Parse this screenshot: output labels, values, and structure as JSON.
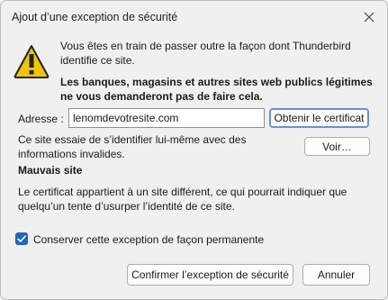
{
  "window": {
    "title": "Ajout d’une exception de sécurité"
  },
  "message": {
    "intro": "Vous êtes en train de passer outre la façon dont Thunderbird identifie ce site.",
    "warning": "Les banques, magasins et autres sites web publics légitimes ne vous demanderont pas de faire cela."
  },
  "address": {
    "label": "Adresse :",
    "value": "lenomdevotresite.com",
    "get_cert_button": "Obtenir le certificat"
  },
  "cert": {
    "status_text": "Ce site essaie de s’identifier lui-même avec des informations invalides.",
    "view_button": "Voir…",
    "problem_heading": "Mauvais site",
    "problem_detail": "Le certificat appartient à un site différent, ce qui pourrait indiquer que quelqu’un tente d’usurper l’identité de ce site."
  },
  "permanent": {
    "label": "Conserver cette exception de façon permanente",
    "checked": true
  },
  "footer": {
    "confirm_button": "Confirmer l’exception de sécurité",
    "cancel_button": "Annuler"
  },
  "colors": {
    "accent": "#1f66c0",
    "warning_yellow": "#f5c400"
  },
  "icons": {
    "close": "close-icon",
    "warning": "warning-icon",
    "check": "checkmark-icon"
  }
}
